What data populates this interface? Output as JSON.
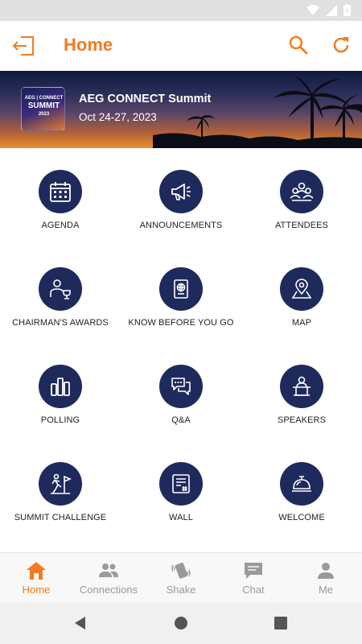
{
  "app_bar": {
    "title": "Home",
    "accent_color": "#f47b20"
  },
  "banner": {
    "event_name": "AEG CONNECT Summit",
    "event_dates": "Oct 24-27, 2023",
    "logo_line1": "AEG | CONNECT",
    "logo_line2": "SUMMIT",
    "logo_line3": "2023"
  },
  "tiles": [
    {
      "label": "AGENDA",
      "icon": "calendar-icon"
    },
    {
      "label": "ANNOUNCEMENTS",
      "icon": "megaphone-icon"
    },
    {
      "label": "ATTENDEES",
      "icon": "attendees-icon"
    },
    {
      "label": "CHAIRMAN'S AWARDS",
      "icon": "trophy-person-icon"
    },
    {
      "label": "KNOW BEFORE YOU GO",
      "icon": "passport-icon"
    },
    {
      "label": "MAP",
      "icon": "map-pin-icon"
    },
    {
      "label": "POLLING",
      "icon": "bar-chart-icon"
    },
    {
      "label": "Q&A",
      "icon": "chat-bubbles-icon"
    },
    {
      "label": "SPEAKERS",
      "icon": "podium-speaker-icon"
    },
    {
      "label": "SUMMIT CHALLENGE",
      "icon": "runner-flag-icon"
    },
    {
      "label": "WALL",
      "icon": "wall-post-icon"
    },
    {
      "label": "WELCOME",
      "icon": "service-bell-icon"
    }
  ],
  "tile_circle_color": "#1f2a5c",
  "bottom_nav": [
    {
      "label": "Home",
      "icon": "home-icon",
      "active": true
    },
    {
      "label": "Connections",
      "icon": "people-icon",
      "active": false
    },
    {
      "label": "Shake",
      "icon": "shake-phone-icon",
      "active": false
    },
    {
      "label": "Chat",
      "icon": "chat-icon",
      "active": false
    },
    {
      "label": "Me",
      "icon": "person-icon",
      "active": false
    }
  ]
}
